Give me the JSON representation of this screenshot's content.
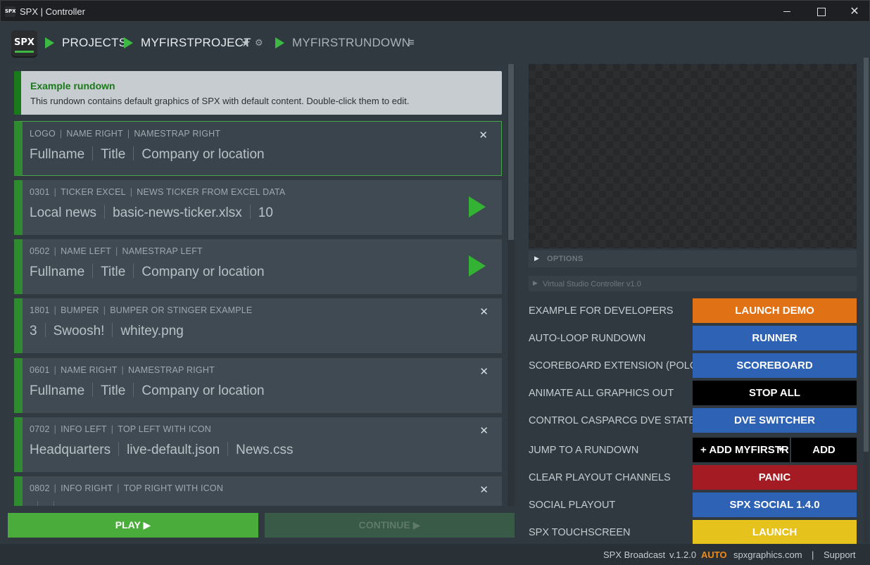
{
  "window": {
    "icon_text": "SPX",
    "title": "SPX | Controller",
    "minimize_glyph": "",
    "maximize_glyph": "",
    "close_glyph": "✕"
  },
  "header": {
    "logo_text": "SPX",
    "crumbs": [
      "PROJECTS",
      "MYFIRSTPROJECT",
      "MYFIRSTRUNDOWN"
    ],
    "star_glyph": "★",
    "cog_glyph": "⚙",
    "menu_glyph": "≡",
    "accent": "#3cb843"
  },
  "notice": {
    "title": "Example rundown",
    "text": "This rundown contains default graphics of SPX with default content. Double-click them to edit."
  },
  "items": [
    {
      "meta": [
        "LOGO",
        "NAME RIGHT",
        "NAMESTRAP RIGHT"
      ],
      "fields": [
        "Fullname",
        "Title",
        "Company or location"
      ],
      "action": "close"
    },
    {
      "meta": [
        "0301",
        "TICKER EXCEL",
        "NEWS TICKER FROM EXCEL DATA"
      ],
      "fields": [
        "Local news",
        "basic-news-ticker.xlsx",
        "10"
      ],
      "action": "play"
    },
    {
      "meta": [
        "0502",
        "NAME LEFT",
        "NAMESTRAP LEFT"
      ],
      "fields": [
        "Fullname",
        "Title",
        "Company or location"
      ],
      "action": "play"
    },
    {
      "meta": [
        "1801",
        "BUMPER",
        "BUMPER OR STINGER EXAMPLE"
      ],
      "fields": [
        "3",
        "Swoosh!",
        "whitey.png"
      ],
      "action": "close"
    },
    {
      "meta": [
        "0601",
        "NAME RIGHT",
        "NAMESTRAP RIGHT"
      ],
      "fields": [
        "Fullname",
        "Title",
        "Company or location"
      ],
      "action": "close"
    },
    {
      "meta": [
        "0702",
        "INFO LEFT",
        "TOP LEFT WITH ICON"
      ],
      "fields": [
        "Headquarters",
        "live-default.json",
        "News.css"
      ],
      "action": "close"
    },
    {
      "meta": [
        "0802",
        "INFO RIGHT",
        "TOP RIGHT WITH ICON"
      ],
      "fields": [
        "",
        "",
        ""
      ],
      "action": "close"
    }
  ],
  "close_glyph": "✕",
  "controls": {
    "play_label": "PLAY ▶",
    "continue_label": "CONTINUE ▶"
  },
  "panel": {
    "options_label": "OPTIONS",
    "options_glyph": "▶",
    "vsc_label": "Virtual Studio Controller v1.0",
    "vsc_glyph": "▶"
  },
  "extensions": [
    {
      "label": "EXAMPLE FOR DEVELOPERS",
      "button": "LAUNCH DEMO",
      "color": "#e07114"
    },
    {
      "label": "AUTO-LOOP RUNDOWN",
      "button": "RUNNER",
      "color": "#2e62b4"
    },
    {
      "label": "SCOREBOARD EXTENSION (POLO)",
      "button": "SCOREBOARD",
      "color": "#2e62b4"
    },
    {
      "label": "ANIMATE ALL GRAPHICS OUT",
      "button": "STOP ALL",
      "color": "#000000"
    },
    {
      "label": "CONTROL CASPARCG DVE STATES",
      "button": "DVE SWITCHER",
      "color": "#2e62b4"
    },
    {
      "label": "JUMP TO A RUNDOWN",
      "select_value": "+ ADD MYFIRSTR",
      "button": "ADD"
    },
    {
      "label": "CLEAR PLAYOUT CHANNELS",
      "button": "PANIC",
      "color": "#a51b24"
    },
    {
      "label": "SOCIAL PLAYOUT",
      "button": "SPX SOCIAL 1.4.0",
      "color": "#2e62b4"
    },
    {
      "label": "SPX TOUCHSCREEN",
      "button": "LAUNCH",
      "color": "#e6c31c"
    }
  ],
  "footer": {
    "product": "SPX Broadcast",
    "version": "v.1.2.0",
    "mode": "AUTO",
    "site": "spxgraphics.com",
    "separator": "|",
    "support": "Support"
  }
}
